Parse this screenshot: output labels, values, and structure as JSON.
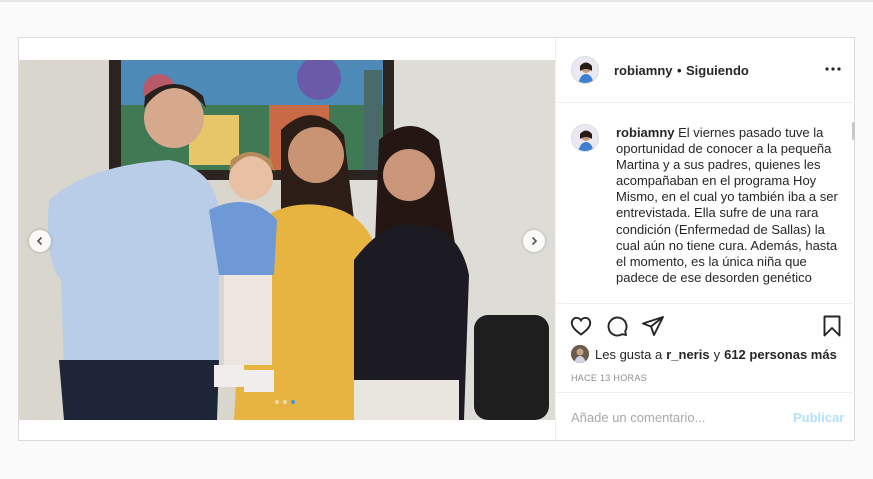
{
  "header": {
    "username": "robiamny",
    "separator": "•",
    "follow_state": "Siguiendo"
  },
  "caption": {
    "username": "robiamny",
    "text": "El viernes pasado tuve la oportunidad de conocer a la pequeña Martina y a sus padres, quienes les acompañaban en el programa Hoy Mismo, en el cual yo también iba a ser entrevistada. Ella sufre de una rara condición (Enfermedad de Sallas) la cual aún no tiene cura. Además, hasta el momento, es la única niña que padece de ese desorden genético"
  },
  "likes": {
    "prefix": "Les gusta a",
    "user": "r_neris",
    "conjunction": "y",
    "others": "612 personas más"
  },
  "timestamp": "HACE 13 HORAS",
  "comment": {
    "placeholder": "Añade un comentario...",
    "publish_label": "Publicar"
  },
  "carousel": {
    "slides": 3,
    "active": 2
  },
  "colors": {
    "accent": "#3897f0",
    "publish_disabled": "#b2dffc",
    "border": "#dbdbdb"
  },
  "icons": [
    "more-options-icon",
    "heart-icon",
    "comment-icon",
    "share-icon",
    "bookmark-icon",
    "chevron-left-icon",
    "chevron-right-icon"
  ]
}
